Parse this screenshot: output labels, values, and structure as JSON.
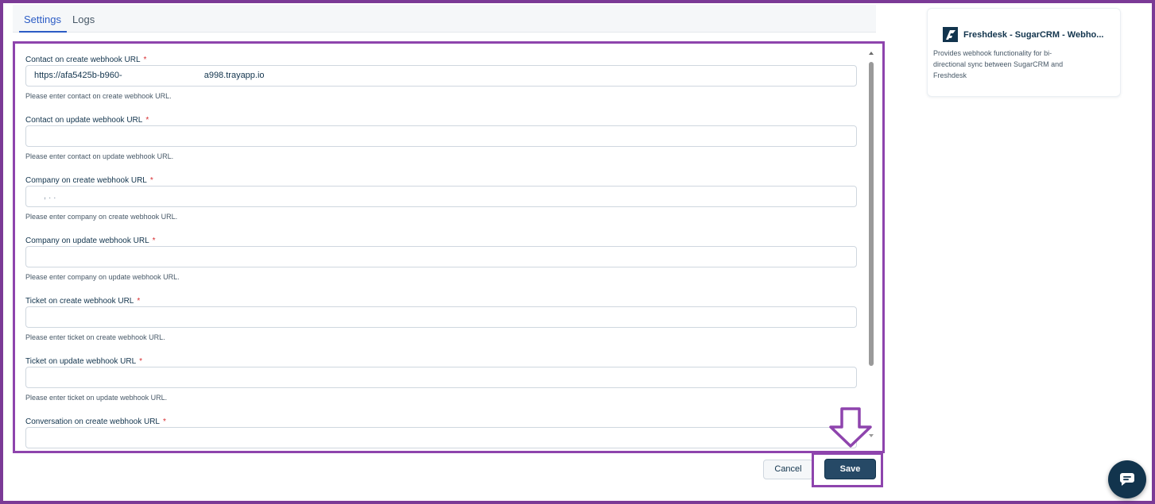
{
  "tabs": {
    "settings": "Settings",
    "logs": "Logs"
  },
  "form": {
    "required_mark": "*",
    "fields": [
      {
        "label": "Contact on create webhook URL",
        "value_parts": [
          "https://afa5425b-b960-",
          "a998.trayapp.io"
        ],
        "placeholder": "",
        "hint": "Please enter contact on create webhook URL."
      },
      {
        "label": "Contact on update webhook URL",
        "value": "",
        "placeholder": "",
        "hint": "Please enter contact on update webhook URL."
      },
      {
        "label": "Company on create webhook URL",
        "value": ",   . .",
        "placeholder": "",
        "hint": "Please enter company on create webhook URL."
      },
      {
        "label": "Company on update webhook URL",
        "value": "",
        "placeholder": "",
        "hint": "Please enter company on update webhook URL."
      },
      {
        "label": "Ticket on create webhook URL",
        "value": "",
        "placeholder": "",
        "hint": "Please enter ticket on create webhook URL."
      },
      {
        "label": "Ticket on update webhook URL",
        "value": "",
        "placeholder": "",
        "hint": "Please enter ticket on update webhook URL."
      },
      {
        "label": "Conversation on create webhook URL",
        "value": "",
        "placeholder": ""
      }
    ]
  },
  "actions": {
    "cancel": "Cancel",
    "save": "Save"
  },
  "app_card": {
    "name": "Freshdesk - SugarCRM - Webho...",
    "description": "Provides webhook functionality for bi-directional sync between SugarCRM and Freshdesk"
  },
  "colors": {
    "primary": "#2c5cc5",
    "save_button": "#264966",
    "highlight": "#8e44ad",
    "required": "#d72d30"
  },
  "icons": {
    "app_logo": "freshdesk-logo-icon",
    "chat": "chat-bubble-icon",
    "annotation": "down-arrow-icon"
  }
}
